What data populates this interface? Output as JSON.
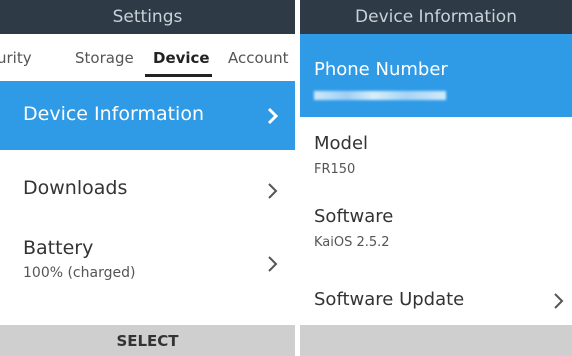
{
  "left_panel": {
    "title": "Settings",
    "tabs": [
      {
        "label": "urity"
      },
      {
        "label": "Storage"
      },
      {
        "label": "Device"
      },
      {
        "label": "Account"
      }
    ],
    "items": [
      {
        "label": "Device Information"
      },
      {
        "label": "Downloads"
      },
      {
        "label": "Battery",
        "sub": "100% (charged)"
      }
    ],
    "softkey_label": "SELECT"
  },
  "right_panel": {
    "title": "Device Information",
    "phone_number_label": "Phone Number",
    "model_label": "Model",
    "model_value": "FR150",
    "software_label": "Software",
    "software_value": "KaiOS 2.5.2",
    "software_update_label": "Software Update"
  },
  "colors": {
    "header_bg": "#2e3a46",
    "highlight": "#2f9be6",
    "softkey_bg": "#cfcfcf"
  }
}
